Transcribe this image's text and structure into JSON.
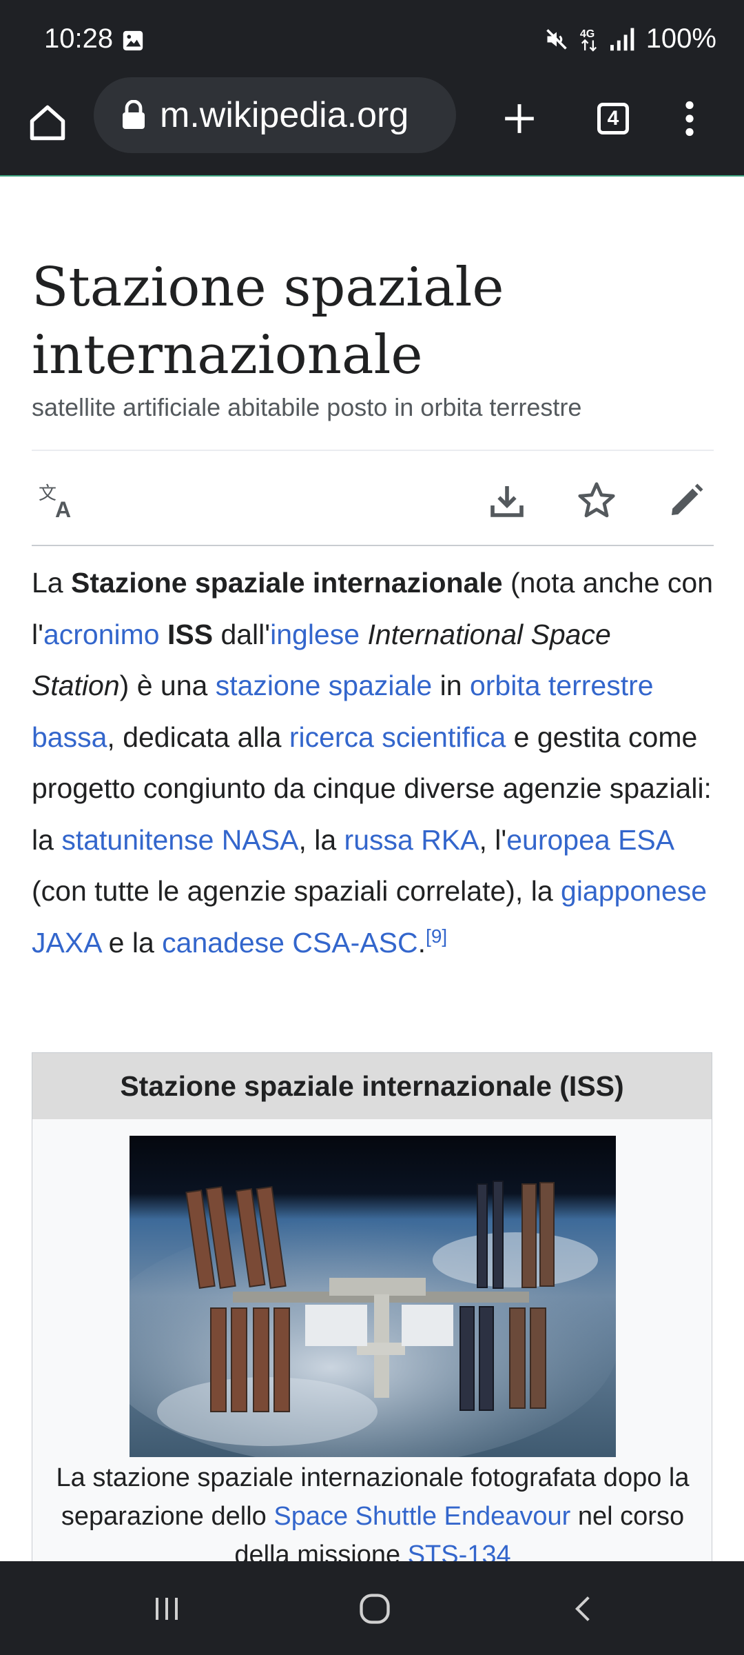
{
  "status_bar": {
    "time": "10:28",
    "battery": "100%",
    "icons": [
      "gallery-icon",
      "mute-icon",
      "4g-icon",
      "signal-icon"
    ]
  },
  "browser": {
    "url": "m.wikipedia.org",
    "tab_count": "4",
    "icons": [
      "home-icon",
      "lock-icon",
      "plus-icon",
      "tabs-icon",
      "overflow-menu-icon"
    ]
  },
  "article": {
    "title": "Stazione spaziale internazionale",
    "subtitle": "satellite artificiale abitabile posto in orbita terrestre",
    "action_icons": [
      "translate-icon",
      "download-icon",
      "star-icon",
      "edit-icon"
    ],
    "intro": {
      "t1": "La ",
      "b1": "Stazione spaziale internazionale",
      "t2": " (nota anche con l'",
      "l1": "acronimo",
      "t3": " ",
      "b2": "ISS",
      "t4": " dall'",
      "l2": "inglese",
      "t5": " ",
      "i1": "International Space Station",
      "t6": ") è una ",
      "l3": "stazione spaziale",
      "t7": " in ",
      "l4": "orbita terrestre bassa",
      "t8": ", dedicata alla ",
      "l5": "ricerca scientifica",
      "t9": " e gestita come progetto congiunto da cinque diverse agenzie spaziali: la ",
      "l6": "statunitense NASA",
      "t10": ", la ",
      "l7": "russa RKA",
      "t11": ", l'",
      "l8": "europea ESA",
      "t12": " (con tutte le agenzie spaziali correlate), la ",
      "l9": "giapponese JAXA",
      "t13": " e la ",
      "l10": "canadese CSA-ASC",
      "t14": ".",
      "ref": "[9]"
    },
    "infobox": {
      "title": "Stazione spaziale internazionale (ISS)",
      "caption_t1": "La stazione spaziale internazionale fotografata dopo la separazione dello ",
      "caption_l1": "Space Shuttle Endeavour",
      "caption_t2": " nel corso della missione ",
      "caption_l2": "STS-134"
    }
  },
  "nav_bar": {
    "icons": [
      "recent-apps-icon",
      "home-circle-icon",
      "back-icon"
    ]
  },
  "colors": {
    "chrome": "#1f2125",
    "link": "#3366cc",
    "text": "#202122"
  }
}
